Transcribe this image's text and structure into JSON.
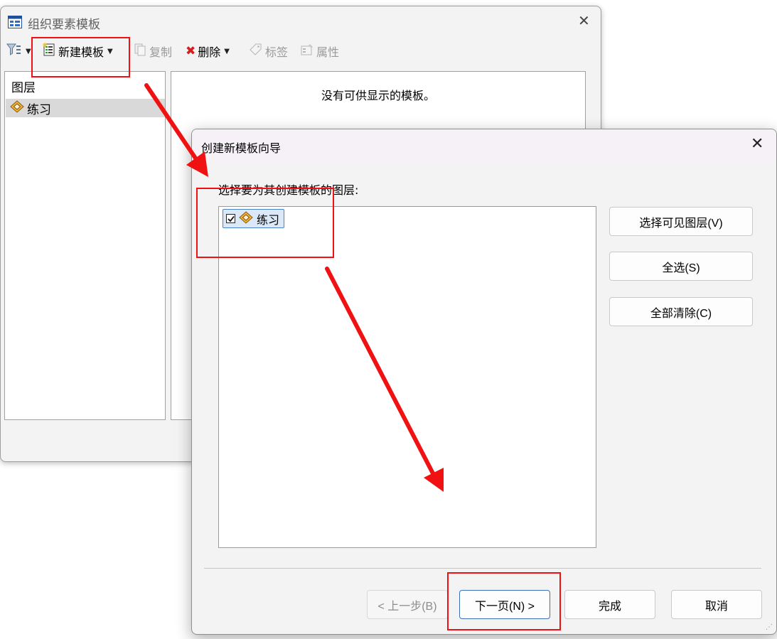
{
  "bg_window": {
    "title": "组织要素模板",
    "close_glyph": "✕",
    "toolbar": {
      "new_template": "新建模板",
      "copy": "复制",
      "delete": "删除",
      "tags": "标签",
      "properties": "属性"
    },
    "layer_panel": {
      "header": "图层",
      "layers": [
        "练习"
      ]
    },
    "template_panel": {
      "empty_message": "没有可供显示的模板。"
    }
  },
  "wizard": {
    "title": "创建新模板向导",
    "close_glyph": "✕",
    "prompt": "选择要为其创建模板的图层:",
    "layer_items": [
      {
        "label": "练习",
        "checked": true
      }
    ],
    "side_buttons": {
      "select_visible": "选择可见图层(V)",
      "select_all": "全选(S)",
      "clear_all": "全部清除(C)"
    },
    "footer": {
      "back": "< 上一步(B)",
      "next": "下一页(N) >",
      "finish": "完成",
      "cancel": "取消"
    }
  },
  "colors": {
    "annotation_red": "#f01212",
    "selection_blue": "#4a83c7",
    "layer_icon_fill": "#f3b233",
    "layer_icon_inner": "#7a4f1c"
  },
  "icons": {
    "app": "table-icon",
    "filter": "filter-icon",
    "new_template": "new-template-icon",
    "copy": "copy-icon",
    "delete": "delete-x-icon",
    "tags": "tag-icon",
    "properties": "properties-icon",
    "layer": "layer-diamond-icon"
  }
}
